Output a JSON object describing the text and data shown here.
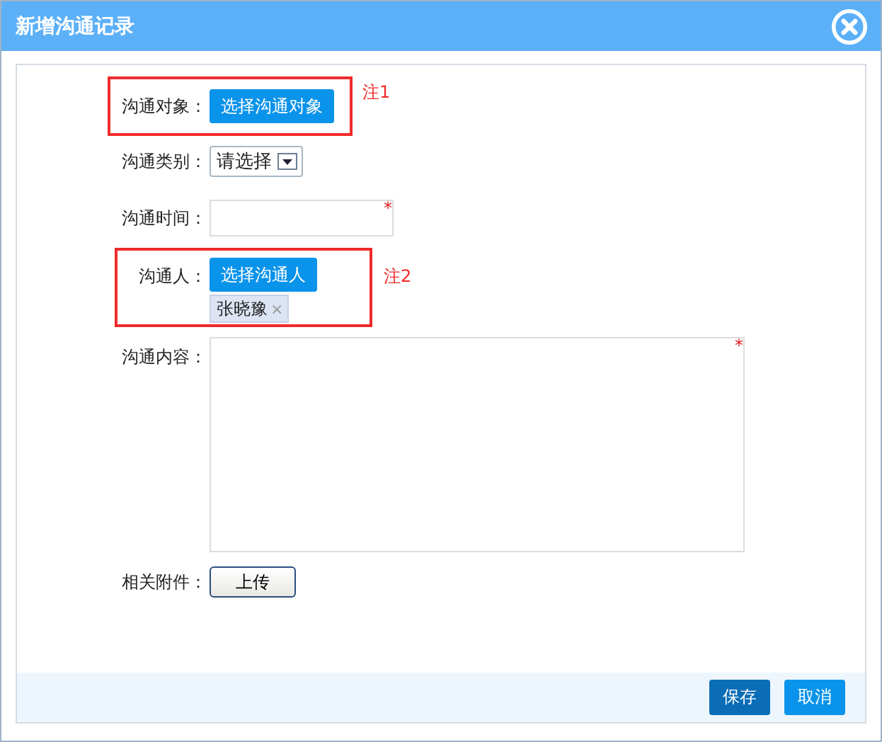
{
  "window": {
    "title": "新增沟通记录"
  },
  "fields": [
    {
      "kind": "picker",
      "label": "沟通对象：",
      "button": "选择沟通对象",
      "note": "注1"
    },
    {
      "kind": "select",
      "label": "沟通类别：",
      "value": "请选择"
    },
    {
      "kind": "input",
      "label": "沟通时间：",
      "required_mark": "*"
    },
    {
      "kind": "people",
      "label": "沟通人：",
      "button": "选择沟通人",
      "note": "注2",
      "people": [
        {
          "name": "张晓豫",
          "remove": "×"
        }
      ]
    },
    {
      "kind": "textarea",
      "label": "沟通内容：",
      "required_mark": "*"
    },
    {
      "kind": "upload",
      "label": "相关附件：",
      "button": "上传"
    }
  ],
  "buttons": [
    {
      "label": "保存",
      "kind": "primary"
    },
    {
      "label": "取消",
      "kind": "secondary"
    }
  ]
}
